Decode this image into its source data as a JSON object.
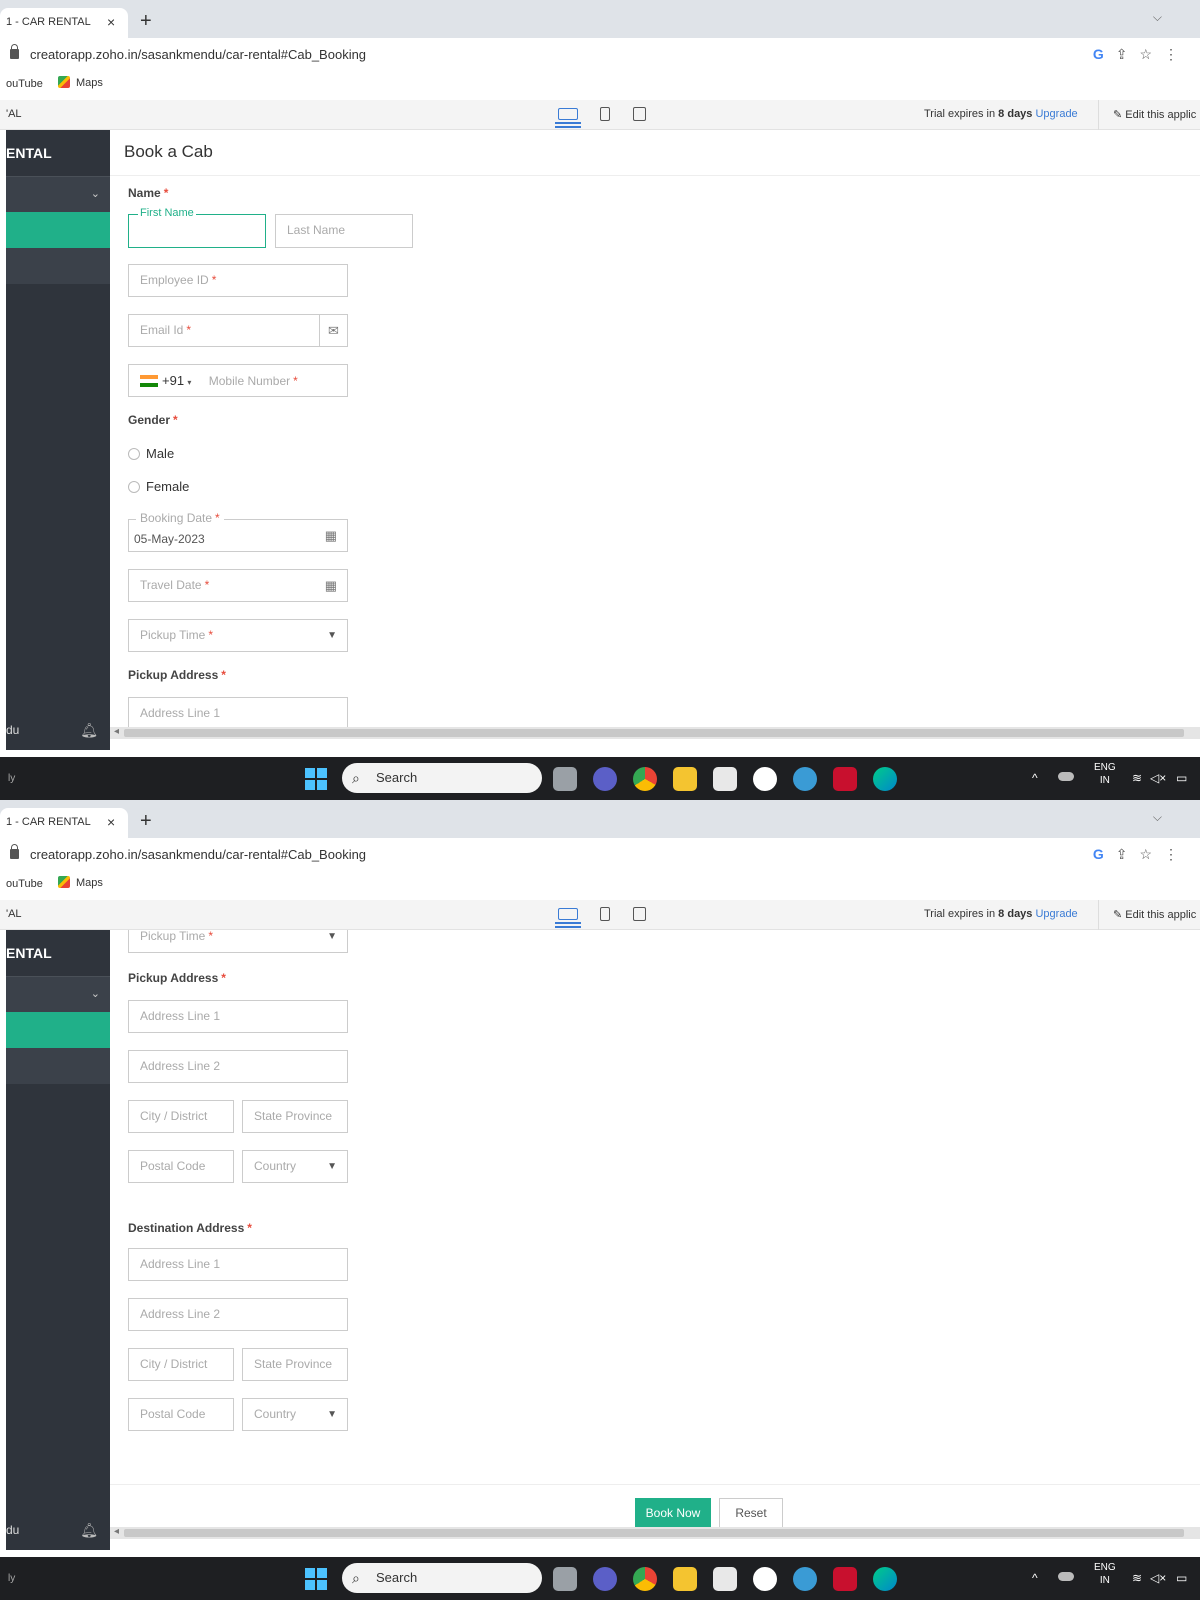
{
  "browser": {
    "tab_title": "1 - CAR RENTAL",
    "tab_close": "×",
    "new_tab": "+",
    "tab_menu": "⌵",
    "url": "creatorapp.zoho.in/sasankmendu/car-rental#Cab_Booking",
    "bookmarks": [
      "ouTube",
      "Maps"
    ]
  },
  "appbar": {
    "title": "'AL",
    "trial_prefix": "Trial expires in ",
    "trial_days": "8 days",
    "upgrade": "Upgrade",
    "edit": "Edit this applic"
  },
  "sidebar": {
    "title": "ENTAL",
    "user": "du"
  },
  "form": {
    "title": "Book a Cab",
    "name_label": "Name",
    "first_name": "First Name",
    "last_name": "Last Name",
    "employee_id": "Employee ID",
    "email": "Email Id",
    "phone_code": "+91",
    "mobile": "Mobile Number",
    "gender_label": "Gender",
    "gender_options": [
      "Male",
      "Female"
    ],
    "booking_date_label": "Booking Date",
    "booking_date_value": "05-May-2023",
    "travel_date": "Travel Date",
    "pickup_time": "Pickup Time",
    "pickup_address_label": "Pickup Address",
    "destination_address_label": "Destination Address",
    "address_line_1": "Address Line 1",
    "address_line_2": "Address Line 2",
    "city": "City / District",
    "state": "State Province",
    "postal": "Postal Code",
    "country": "Country",
    "required_mark": "*",
    "book_now": "Book Now",
    "reset": "Reset"
  },
  "taskbar": {
    "search": "Search",
    "left_text": "ly",
    "lang_top": "ENG",
    "lang_bottom": "IN"
  },
  "colors": {
    "accent": "#20b089",
    "sidebar": "#2f343c",
    "link": "#3a7bd5"
  }
}
